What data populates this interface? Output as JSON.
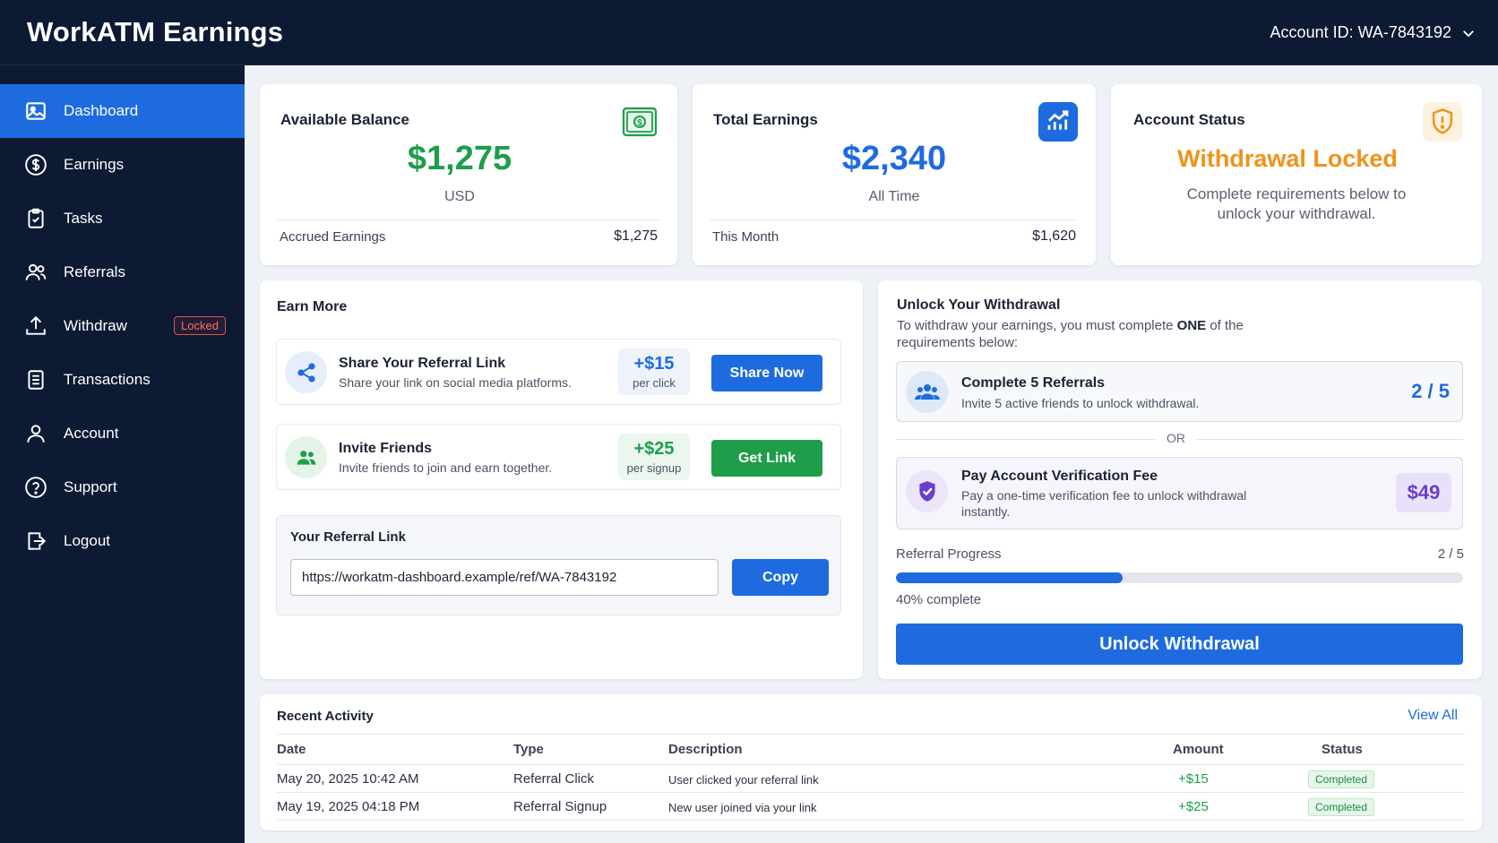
{
  "header": {
    "title": "WorkATM Earnings",
    "account_id": "Account ID: WA-7843192"
  },
  "sidebar": {
    "items": [
      {
        "label": "Dashboard",
        "icon": "image-icon",
        "active": true
      },
      {
        "label": "Earnings",
        "icon": "dollar-circle-icon"
      },
      {
        "label": "Tasks",
        "icon": "clipboard-check-icon"
      },
      {
        "label": "Referrals",
        "icon": "users-icon"
      },
      {
        "label": "Withdraw",
        "icon": "upload-icon",
        "badge": "Locked"
      },
      {
        "label": "Transactions",
        "icon": "document-icon"
      },
      {
        "label": "Account",
        "icon": "user-icon"
      },
      {
        "label": "Support",
        "icon": "help-circle-icon"
      },
      {
        "label": "Logout",
        "icon": "logout-icon"
      }
    ]
  },
  "balance": {
    "title": "Available Balance",
    "value": "$1,275",
    "unit": "USD",
    "foot_label": "Accrued Earnings",
    "foot_value": "$1,275"
  },
  "earnings": {
    "title": "Total Earnings",
    "value": "$2,340",
    "unit": "All Time",
    "foot_label": "This Month",
    "foot_value": "$1,620"
  },
  "status": {
    "title": "Account Status",
    "value": "Withdrawal Locked",
    "desc": "Complete requirements below to unlock your withdrawal."
  },
  "earn_more": {
    "title": "Earn More",
    "items": [
      {
        "title": "Share Your Referral Link",
        "desc": "Share your link on social media platforms.",
        "reward": "+$15",
        "unit": "per click",
        "button": "Share Now"
      },
      {
        "title": "Invite Friends",
        "desc": "Invite friends to join and earn together.",
        "reward": "+$25",
        "unit": "per signup",
        "button": "Get Link"
      }
    ],
    "referral": {
      "title": "Your Referral Link",
      "url": "https://workatm-dashboard.example/ref/WA-7843192",
      "copy": "Copy"
    }
  },
  "unlock": {
    "title": "Unlock Your Withdrawal",
    "sub_pre": "To withdraw your earnings, you must complete ",
    "sub_bold": "ONE",
    "sub_post": " of the requirements below:",
    "req1": {
      "title": "Complete 5 Referrals",
      "desc": "Invite 5 active friends to unlock withdrawal.",
      "progress": "2 / 5"
    },
    "or": "OR",
    "req2": {
      "title": "Pay Account Verification Fee",
      "desc": "Pay a one-time verification fee to unlock withdrawal instantly.",
      "price": "$49"
    },
    "progress_label": "Referral Progress",
    "progress_count": "2 / 5",
    "progress_fraction": 0.4,
    "progress_pct": "40% complete",
    "button": "Unlock Withdrawal"
  },
  "activity": {
    "title": "Recent Activity",
    "view_all": "View All",
    "columns": [
      "Date",
      "Type",
      "Description",
      "Amount",
      "Status"
    ],
    "rows": [
      {
        "date": "May 20, 2025 10:42 AM",
        "type": "Referral Click",
        "desc": "User clicked your referral link",
        "amount": "+$15",
        "status": "Completed"
      },
      {
        "date": "May 19, 2025 04:18 PM",
        "type": "Referral Signup",
        "desc": "New user joined via your link",
        "amount": "+$25",
        "status": "Completed"
      }
    ]
  },
  "colors": {
    "accent": "#1e6be0",
    "green": "#1e9e4a",
    "orange": "#f0921b",
    "navy": "#0c1a33",
    "purple": "#6a3fc9"
  }
}
